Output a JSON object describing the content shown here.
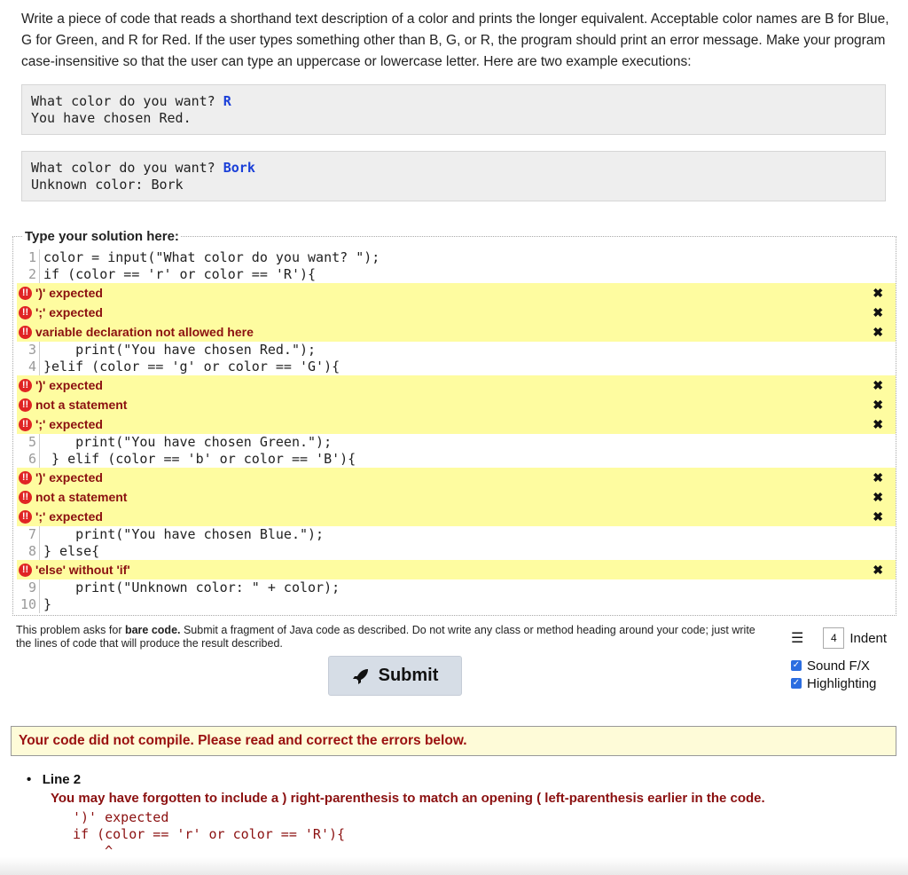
{
  "prompt": "Write a piece of code that reads a shorthand text description of a color and prints the longer equivalent. Acceptable color names are B for Blue, G for Green, and R for Red. If the user types something other than B, G, or R, the program should print an error message. Make your program case-insensitive so that the user can type an uppercase or lowercase letter. Here are two example executions:",
  "examples": [
    {
      "line1_prefix": "What color do you want? ",
      "line1_input": "R",
      "line2": "You have chosen Red."
    },
    {
      "line1_prefix": "What color do you want? ",
      "line1_input": "Bork",
      "line2": "Unknown color: Bork"
    }
  ],
  "solution": {
    "title": "Type your solution here:",
    "code": [
      "color = input(\"What color do you want? \");",
      "if (color == 'r' or color == 'R'){",
      "    print(\"You have chosen Red.\");",
      "}elif (color == 'g' or color == 'G'){",
      "    print(\"You have chosen Green.\");",
      " } elif (color == 'b' or color == 'B'){",
      "    print(\"You have chosen Blue.\");",
      "} else{",
      "    print(\"Unknown color: \" + color);",
      "}"
    ],
    "line_numbers": [
      "1",
      "2",
      "3",
      "4",
      "5",
      "6",
      "7",
      "8",
      "9",
      "10"
    ],
    "errors": [
      "')' expected",
      "';' expected",
      "variable declaration not allowed here",
      "')' expected",
      "not a statement",
      "';' expected",
      "')' expected",
      "not a statement",
      "';' expected",
      "'else' without 'if'"
    ]
  },
  "bare_code_note": {
    "prefix": "This problem asks for ",
    "bold": "bare code.",
    "suffix": " Submit a fragment of Java code as described. Do not write any class or method heading around your code; just write the lines of code that will produce the result described."
  },
  "submit_label": "Submit",
  "options": {
    "indent_value": "4",
    "indent_label": "Indent",
    "sound_label": "Sound F/X",
    "highlight_label": "Highlighting"
  },
  "compile_message": "Your code did not compile. Please read and correct the errors below.",
  "detail": {
    "line_label": "Line 2",
    "hint": "You may have forgotten to include a ) right-parenthesis to match an opening ( left-parenthesis earlier in the code.",
    "error_text": "')' expected",
    "code_line": "if (color == 'r' or color == 'R'){",
    "caret": "    ^"
  },
  "colors": {
    "error_bg": "#fefca0",
    "error_text": "#8b1010",
    "input_blue": "#1a3fd8"
  }
}
